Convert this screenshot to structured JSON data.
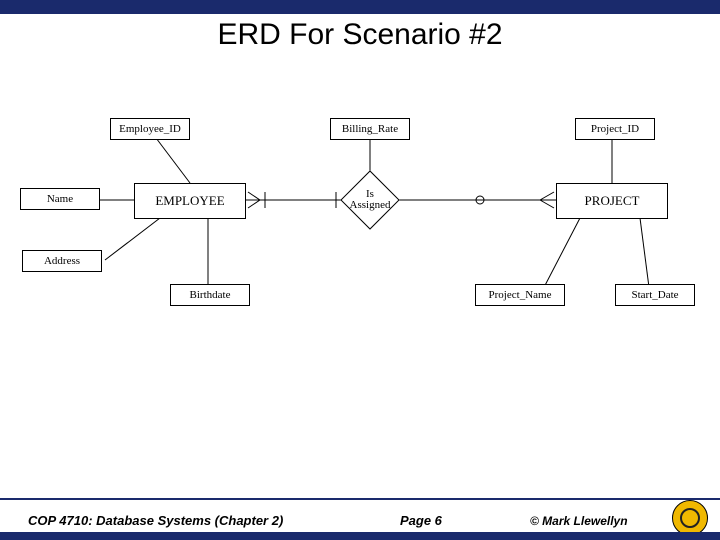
{
  "title": "ERD For Scenario #2",
  "entities": {
    "employee": "EMPLOYEE",
    "project": "PROJECT"
  },
  "relationship": {
    "is_assigned_l1": "Is",
    "is_assigned_l2": "Assigned"
  },
  "attributes": {
    "employee_id": "Employee_ID",
    "billing_rate": "Billing_Rate",
    "project_id": "Project_ID",
    "name": "Name",
    "address": "Address",
    "birthdate": "Birthdate",
    "project_name": "Project_Name",
    "start_date": "Start_Date"
  },
  "footer": {
    "course": "COP 4710: Database Systems  (Chapter 2)",
    "page": "Page 6",
    "copyright": "© Mark Llewellyn"
  },
  "chart_data": {
    "type": "erd",
    "entities": [
      {
        "name": "EMPLOYEE",
        "attributes": [
          {
            "name": "Employee_ID",
            "key": true
          },
          {
            "name": "Name"
          },
          {
            "name": "Address"
          },
          {
            "name": "Birthdate"
          }
        ]
      },
      {
        "name": "PROJECT",
        "attributes": [
          {
            "name": "Project_ID",
            "key": true
          },
          {
            "name": "Project_Name"
          },
          {
            "name": "Start_Date"
          }
        ]
      }
    ],
    "relationships": [
      {
        "name": "Is Assigned",
        "between": [
          "EMPLOYEE",
          "PROJECT"
        ],
        "attributes": [
          {
            "name": "Billing_Rate"
          }
        ],
        "cardinality": {
          "EMPLOYEE": "one-or-many",
          "PROJECT": "zero-or-many"
        }
      }
    ]
  }
}
